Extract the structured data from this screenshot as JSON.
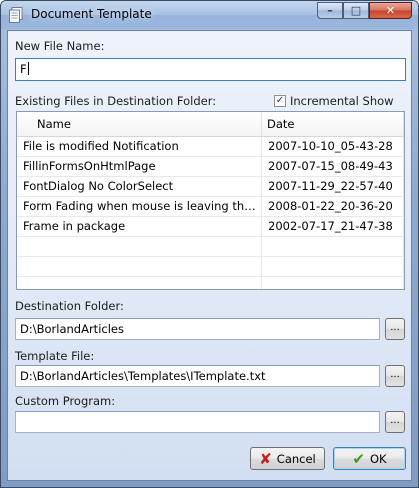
{
  "window": {
    "title": "Document Template",
    "minimize": "–",
    "maximize": "□",
    "close": "✕"
  },
  "new_file": {
    "label": "New File Name:",
    "value": "F"
  },
  "existing": {
    "label": "Existing Files in Destination Folder:",
    "incremental_label": "Incremental Show",
    "incremental_checked": "✓",
    "columns": {
      "name": "Name",
      "date": "Date"
    },
    "rows": [
      {
        "name": "File is modified Notification",
        "date": "2007-10-10_05-43-28"
      },
      {
        "name": "FillinFormsOnHtmlPage",
        "date": "2007-07-15_08-49-43"
      },
      {
        "name": "FontDialog No ColorSelect",
        "date": "2007-11-29_22-57-40"
      },
      {
        "name": "Form Fading when mouse is leaving the ...",
        "date": "2008-01-22_20-36-20"
      },
      {
        "name": "Frame in package",
        "date": "2002-07-17_21-47-38"
      }
    ]
  },
  "destination": {
    "label": "Destination Folder:",
    "value": "D:\\BorlandArticles",
    "browse": "..."
  },
  "template": {
    "label": "Template File:",
    "value": "D:\\BorlandArticles\\Templates\\ITemplate.txt",
    "browse": "..."
  },
  "custom": {
    "label": "Custom Program:",
    "value": "",
    "browse": "..."
  },
  "buttons": {
    "cancel": "Cancel",
    "ok": "OK"
  }
}
